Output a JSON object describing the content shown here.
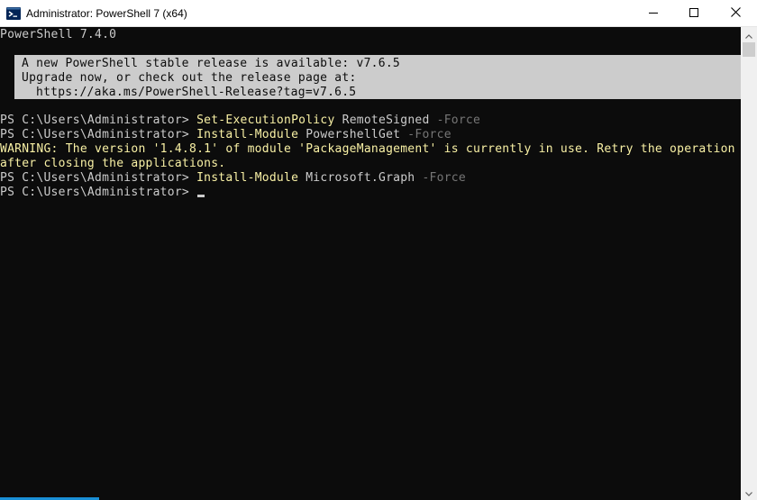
{
  "window": {
    "title": "Administrator: PowerShell 7 (x64)",
    "icon": "powershell-icon"
  },
  "controls": {
    "minimize_icon": "minimize-icon",
    "maximize_icon": "maximize-icon",
    "close_icon": "close-icon"
  },
  "console": {
    "version_line": "PowerShell 7.4.0",
    "notice": {
      "line1": "A new PowerShell stable release is available: v7.6.5",
      "line2": "Upgrade now, or check out the release page at:",
      "line3": "https://aka.ms/PowerShell-Release?tag=v7.6.5"
    },
    "history": [
      {
        "prompt": "PS C:\\Users\\Administrator> ",
        "command": "Set-ExecutionPolicy",
        "argument": " RemoteSigned",
        "parameter": " -Force"
      },
      {
        "prompt": "PS C:\\Users\\Administrator> ",
        "command": "Install-Module",
        "argument": " PowershellGet",
        "parameter": " -Force"
      }
    ],
    "warning": {
      "line1": "WARNING: The version '1.4.8.1' of module 'PackageManagement' is currently in use. Retry the operation",
      "line2": "after closing the applications."
    },
    "last_command": {
      "prompt": "PS C:\\Users\\Administrator> ",
      "command": "Install-Module",
      "argument": " Microsoft.Graph",
      "parameter": " -Force"
    },
    "current_prompt": "PS C:\\Users\\Administrator> "
  },
  "colors": {
    "background": "#0c0c0c",
    "foreground": "#cccccc",
    "command": "#f9f1a5",
    "parameter": "#767676",
    "warning": "#f9f1a5",
    "notice_background": "#cccccc"
  }
}
